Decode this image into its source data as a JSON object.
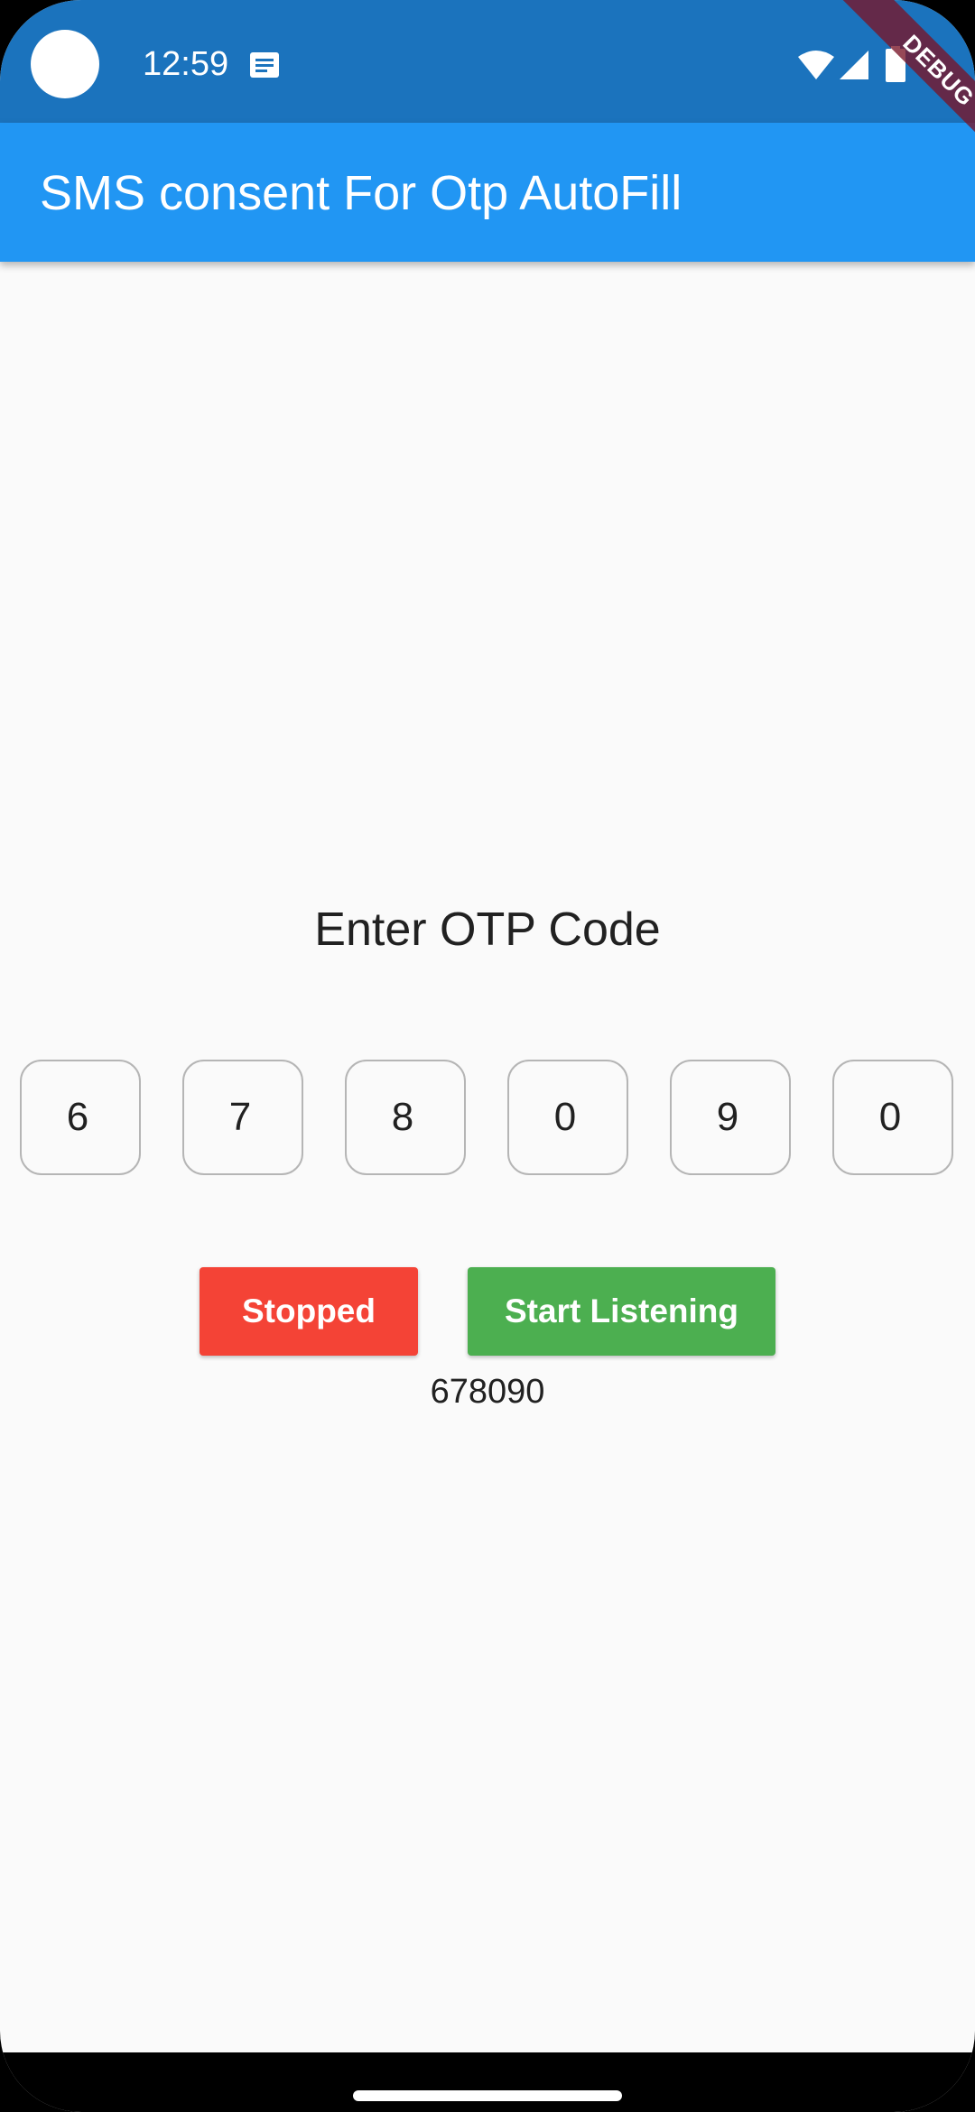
{
  "status_bar": {
    "time": "12:59",
    "icons": [
      "camera-dot",
      "message-icon",
      "wifi-icon",
      "signal-icon",
      "battery-icon"
    ],
    "background": "#1b73bd"
  },
  "debug_banner": {
    "label": "DEBUG"
  },
  "app_bar": {
    "title": "SMS consent For Otp AutoFill",
    "background": "#2196f3"
  },
  "otp": {
    "heading": "Enter OTP Code",
    "digits": [
      "6",
      "7",
      "8",
      "0",
      "9",
      "0"
    ],
    "value": "678090"
  },
  "buttons": {
    "stop_label": "Stopped",
    "stop_color": "#f44336",
    "start_label": "Start Listening",
    "start_color": "#4caf50"
  }
}
